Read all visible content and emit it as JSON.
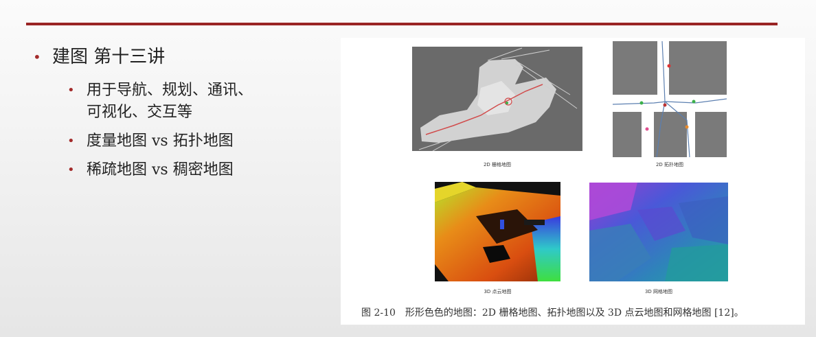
{
  "slide": {
    "bullets": [
      {
        "text": "建图 第十三讲"
      },
      {
        "text": "用于导航、规划、通讯、可视化、交互等",
        "line1": "用于导航、规划、通讯、",
        "line2": "可视化、交互等"
      },
      {
        "text": "度量地图 vs 拓扑地图"
      },
      {
        "text": "稀疏地图 vs 稠密地图"
      }
    ],
    "bullet_color": "#a32b2b",
    "rule_color": "#9a2424"
  },
  "figure": {
    "sublabels": [
      "2D 栅格地图",
      "2D 拓扑地图",
      "3D 点云地图",
      "3D 网格地图"
    ],
    "caption": "图 2-10　形形色色的地图：2D 栅格地图、拓扑地图以及 3D 点云地图和网格地图 [12]。"
  }
}
